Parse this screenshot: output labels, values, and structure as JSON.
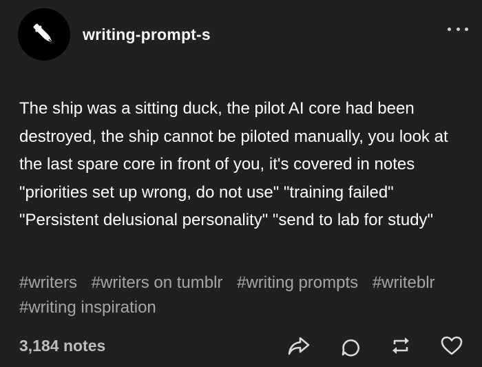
{
  "post": {
    "blog_name": "writing-prompt-s",
    "body": "The ship was a sitting duck, the pilot AI core had been destroyed, the ship cannot be piloted manually, you look at the last spare core in front of you, it's covered in notes \"priorities set up wrong, do not use\" \"training failed\" \"Persistent delusional personality\" \"send to lab for study\"",
    "tags": [
      "#writers",
      "#writers on tumblr",
      "#writing prompts",
      "#writeblr",
      "#writing inspiration"
    ],
    "notes": "3,184 notes"
  },
  "icons": {
    "avatar": "pen-icon",
    "more": "more-dots-icon",
    "share": "share-icon",
    "reply": "reply-icon",
    "reblog": "reblog-icon",
    "like": "heart-icon"
  },
  "colors": {
    "background": "#202020",
    "text": "#ffffff",
    "tags": "#a6a6a6",
    "notes": "#bdbdbd",
    "icons": "#d9d9d9"
  }
}
